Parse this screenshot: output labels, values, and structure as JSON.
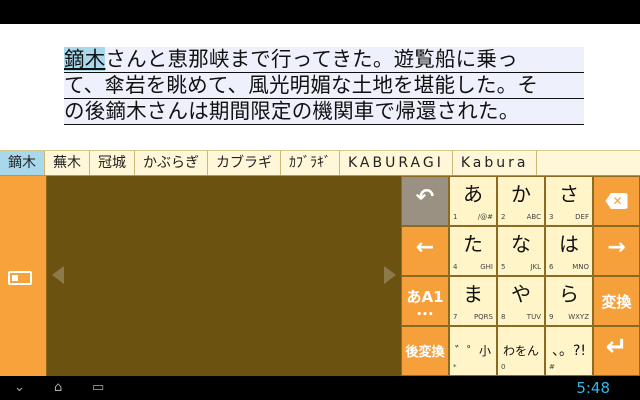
{
  "editor": {
    "composing": "鏑木",
    "line1_rest": "さんと恵那峡まで行ってきた。遊覧船に乗っ",
    "line2": "て、傘岩を眺めて、風光明媚な土地を堪能した。そ",
    "line3": "の後鏑木さんは期間限定の機関車で帰還された。"
  },
  "candidates": [
    "鏑木",
    "蕪木",
    "冠城",
    "かぶらぎ",
    "カブラギ",
    "ｶﾌﾞﾗｷﾞ",
    "KABURAGI",
    "Kabura"
  ],
  "keys": {
    "undo": "↶",
    "left": "←",
    "mode": "あA1",
    "mode_dots": "•••",
    "reconvert": "後変換",
    "a": {
      "kana": "あ",
      "sub": [
        "1",
        "/@#"
      ]
    },
    "ka": {
      "kana": "か",
      "sub": [
        "2",
        "ABC"
      ]
    },
    "sa": {
      "kana": "さ",
      "sub": [
        "3",
        "DEF"
      ]
    },
    "ta": {
      "kana": "た",
      "sub": [
        "4",
        "GHI"
      ]
    },
    "na": {
      "kana": "な",
      "sub": [
        "5",
        "JKL"
      ]
    },
    "ha": {
      "kana": "は",
      "sub": [
        "6",
        "MNO"
      ]
    },
    "ma": {
      "kana": "ま",
      "sub": [
        "7",
        "PQRS"
      ]
    },
    "ya": {
      "kana": "や",
      "sub": [
        "8",
        "TUV"
      ]
    },
    "ra": {
      "kana": "ら",
      "sub": [
        "9",
        "WXYZ"
      ]
    },
    "dakuten": {
      "kana": "゛゜小",
      "sub": [
        "*",
        ""
      ]
    },
    "wa": {
      "kana": "わをん",
      "sub": [
        "0",
        ""
      ]
    },
    "punct": {
      "kana": "、。?!",
      "sub": [
        "#",
        ""
      ]
    },
    "delete": "✕",
    "right": "→",
    "convert": "変換",
    "enter": "↵"
  },
  "navbar": {
    "back": "⌄",
    "home": "⌂",
    "recent": "▭",
    "clock": "5:48"
  }
}
